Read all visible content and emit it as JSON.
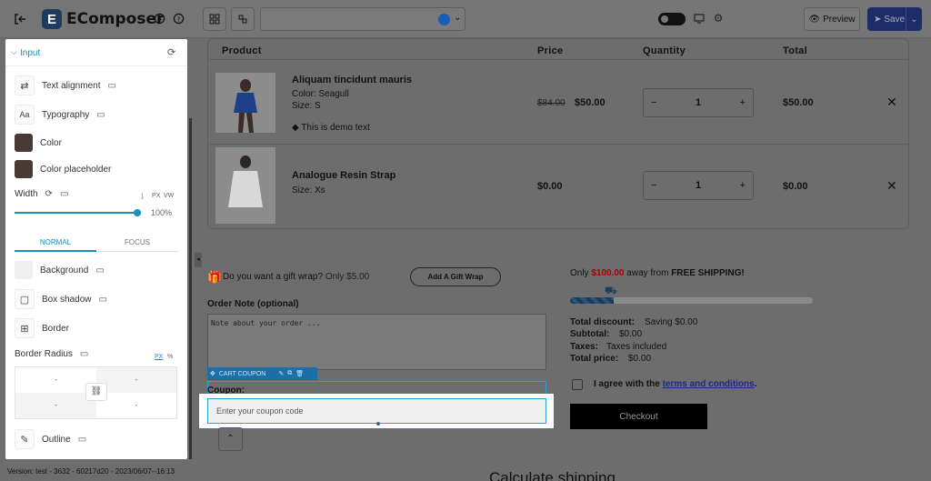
{
  "app": {
    "name": "EComposer"
  },
  "toolbar": {
    "preview_label": "Preview",
    "save_label": "Save"
  },
  "panel": {
    "section_title": "Input",
    "text_alignment": "Text alignment",
    "typography": "Typography",
    "color": "Color",
    "color_placeholder": "Color placeholder",
    "width_label": "Width",
    "unit_px": "PX",
    "unit_vw": "VW",
    "width_value": "100%",
    "width_fraction": 1.0,
    "tab_normal": "NORMAL",
    "tab_focus": "FOCUS",
    "background": "Background",
    "box_shadow": "Box shadow",
    "border": "Border",
    "border_radius": "Border Radius",
    "radius_unit_px": "PX",
    "radius_unit_pct": "%",
    "radius_values": [
      "-",
      "-",
      "-",
      "-"
    ],
    "outline": "Outline",
    "colors": {
      "color": "#4a3a36",
      "accent": "#1a8fb8"
    }
  },
  "cart": {
    "headers": {
      "product": "Product",
      "price": "Price",
      "quantity": "Quantity",
      "total": "Total"
    },
    "items": [
      {
        "name": "Aliquam tincidunt mauris",
        "color": "Color: Seagull",
        "size": "Size: S",
        "note": "This is demo text",
        "old_price": "$84.00",
        "price": "$50.00",
        "qty": "1",
        "total": "$50.00"
      },
      {
        "name": "Analogue Resin Strap",
        "size": "Size: Xs",
        "price": "$0.00",
        "qty": "1",
        "total": "$0.00"
      }
    ]
  },
  "gift": {
    "question": "Do you want a gift wrap?",
    "price": "Only $5.00",
    "button": "Add A Gift Wrap"
  },
  "order_note": {
    "label": "Order Note (optional)",
    "placeholder": "Note about your order ..."
  },
  "coupon": {
    "tag": "CART COUPON",
    "label": "Coupon:",
    "placeholder": "Enter your coupon code"
  },
  "shipping": {
    "prefix": "Only",
    "amount": "$100.00",
    "middle": "away from",
    "suffix": "FREE SHIPPING!",
    "progress": 0.18
  },
  "summary": {
    "discount_label": "Total discount:",
    "discount_value": "Saving $0.00",
    "subtotal_label": "Subtotal:",
    "subtotal_value": "$0.00",
    "taxes_label": "Taxes:",
    "taxes_value": "Taxes included",
    "total_label": "Total price:",
    "total_value": "$0.00"
  },
  "terms": {
    "prefix": "I agree with the",
    "link": "terms and conditions",
    "suffix": "."
  },
  "checkout": {
    "label": "Checkout"
  },
  "calc_shipping": "Calculate shipping",
  "version": "Version: test - 3632 - 60217d20 - 2023/06/07--16:13"
}
